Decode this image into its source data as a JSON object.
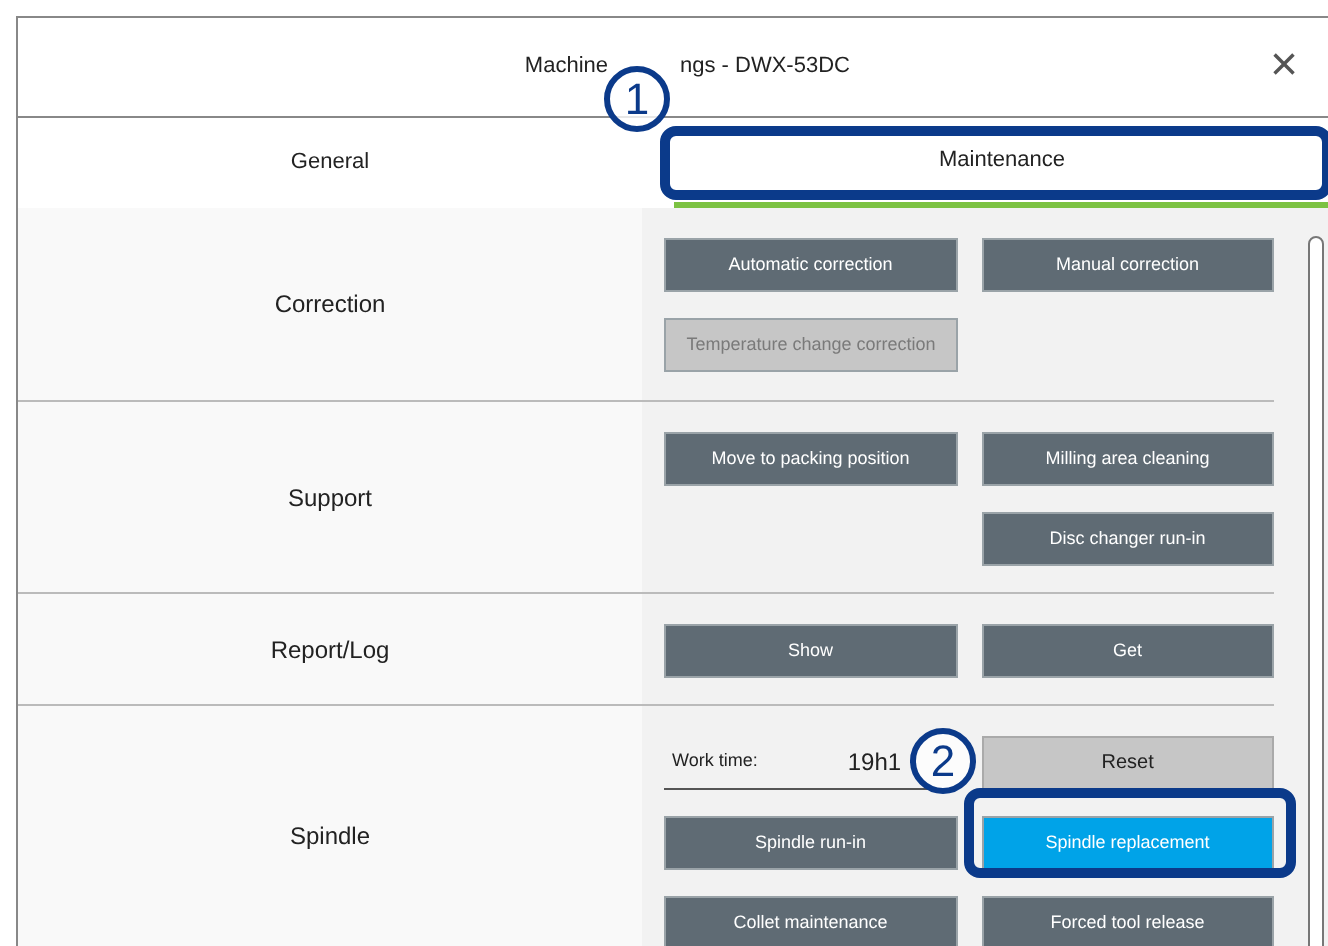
{
  "window": {
    "title_parts": [
      "Machine",
      "ngs - DWX-53DC"
    ],
    "close": "×"
  },
  "tabs": [
    {
      "label": "General",
      "selected": false
    },
    {
      "label": "Maintenance",
      "selected": true
    }
  ],
  "sections": [
    {
      "label": "Correction",
      "rows": [
        [
          {
            "kind": "button",
            "label": "Automatic correction",
            "disabled": false,
            "selected": false
          },
          {
            "kind": "button",
            "label": "Manual correction",
            "disabled": false,
            "selected": false
          }
        ],
        [
          {
            "kind": "button",
            "label": "Temperature change correction",
            "disabled": true,
            "selected": false
          }
        ]
      ]
    },
    {
      "label": "Support",
      "rows": [
        [
          {
            "kind": "button",
            "label": "Move to packing position",
            "disabled": false,
            "selected": false
          },
          {
            "kind": "button",
            "label": "Milling area cleaning",
            "disabled": false,
            "selected": false
          }
        ],
        [
          {
            "kind": "blank"
          },
          {
            "kind": "button",
            "label": "Disc changer run-in",
            "disabled": false,
            "selected": false
          }
        ]
      ]
    },
    {
      "label": "Report/Log",
      "rows": [
        [
          {
            "kind": "button",
            "label": "Show",
            "disabled": false,
            "selected": false
          },
          {
            "kind": "button",
            "label": "Get",
            "disabled": false,
            "selected": false
          }
        ]
      ]
    },
    {
      "label": "Spindle",
      "rows": [
        [
          {
            "kind": "field",
            "label": "Work time:",
            "value": "19h1"
          },
          {
            "kind": "plain",
            "label": "Reset"
          }
        ],
        [
          {
            "kind": "button",
            "label": "Spindle run-in",
            "disabled": false,
            "selected": false
          },
          {
            "kind": "button",
            "label": "Spindle replacement",
            "disabled": false,
            "selected": true
          }
        ],
        [
          {
            "kind": "button",
            "label": "Collet maintenance",
            "disabled": false,
            "selected": false
          },
          {
            "kind": "button",
            "label": "Forced tool release",
            "disabled": false,
            "selected": false
          }
        ]
      ]
    }
  ],
  "callouts": [
    {
      "number": "1"
    },
    {
      "number": "2"
    }
  ]
}
